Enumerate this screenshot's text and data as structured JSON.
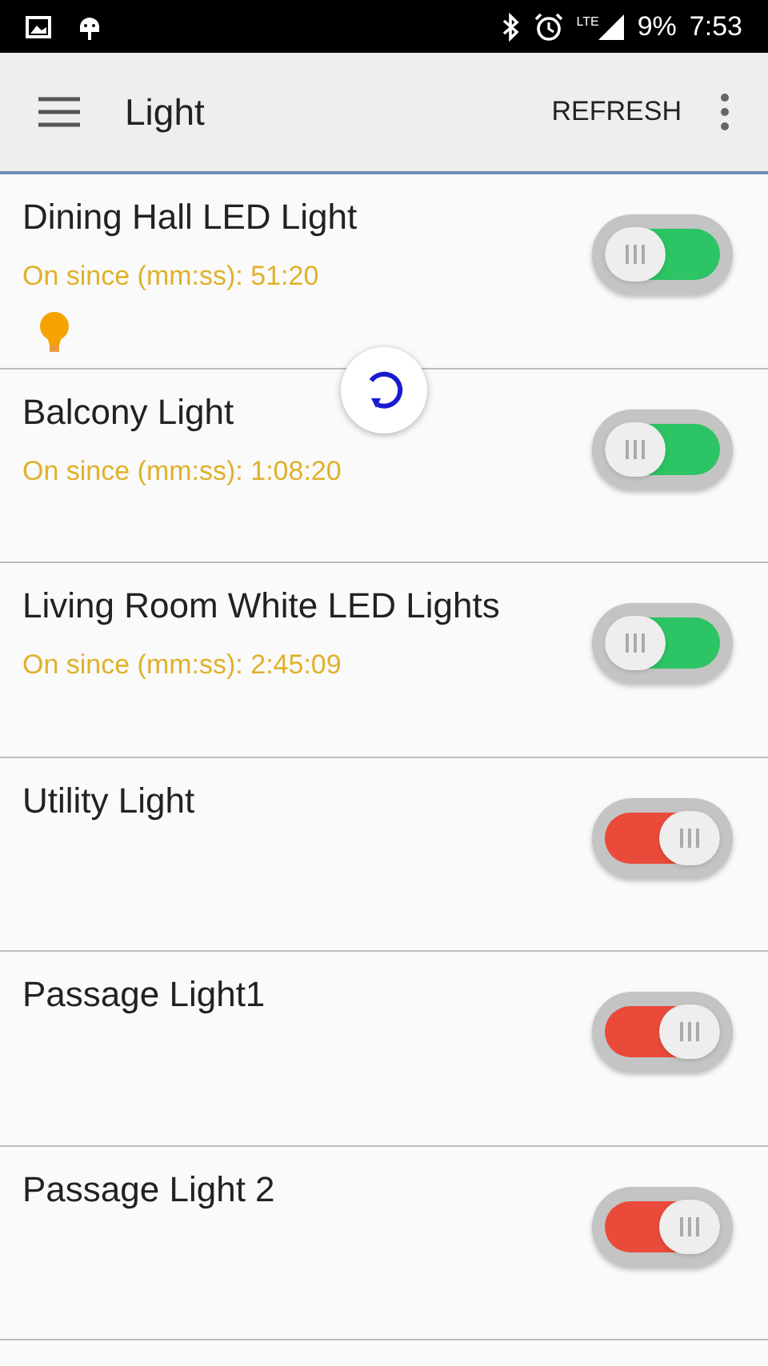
{
  "status_bar": {
    "network": "LTE",
    "battery": "9%",
    "time": "7:53"
  },
  "toolbar": {
    "title": "Light",
    "action": "REFRESH"
  },
  "lights": [
    {
      "name": "Dining Hall LED Light",
      "on": true,
      "since": "On since (mm:ss): 51:20",
      "bulb": true
    },
    {
      "name": "Balcony Light",
      "on": true,
      "since": "On since (mm:ss): 1:08:20",
      "bulb": false
    },
    {
      "name": "Living Room White LED Lights",
      "on": true,
      "since": "On since (mm:ss): 2:45:09",
      "bulb": false
    },
    {
      "name": "Utility Light",
      "on": false,
      "bulb": false
    },
    {
      "name": "Passage Light1",
      "on": false,
      "bulb": false
    },
    {
      "name": "Passage Light 2",
      "on": false,
      "bulb": false
    }
  ],
  "refreshing": true
}
